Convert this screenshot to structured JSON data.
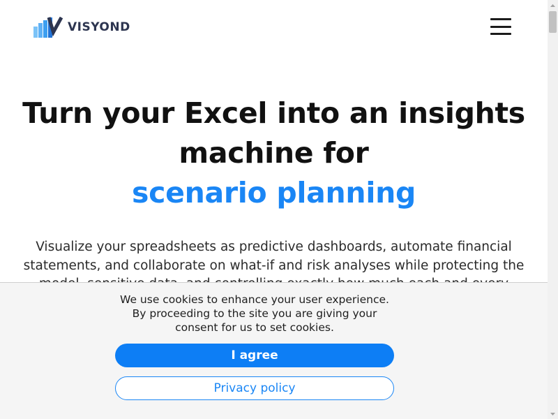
{
  "brand": {
    "name": "VISYOND",
    "colors": {
      "bar_light": "#7cc3f7",
      "bar_mid": "#3d9ff0",
      "bar_dark": "#2273d6",
      "v_stroke": "#2d3550",
      "text": "#2d3550"
    }
  },
  "header": {
    "menu_icon": "hamburger-menu-icon"
  },
  "hero": {
    "title_line1": "Turn your Excel into an insights machine for",
    "title_accent": "scenario planning",
    "description": "Visualize your spreadsheets as predictive dashboards, automate financial statements, and collaborate on what-if and risk analyses while protecting the model, sensitive data, and controlling exactly how much each and every",
    "accent_color": "#1a86f5"
  },
  "cookie_banner": {
    "message": "We use cookies to enhance your user experience. By proceeding to the site you are giving your consent for us to set cookies.",
    "agree_label": "I agree",
    "privacy_label": "Privacy policy",
    "primary_color": "#0d7ef5"
  }
}
